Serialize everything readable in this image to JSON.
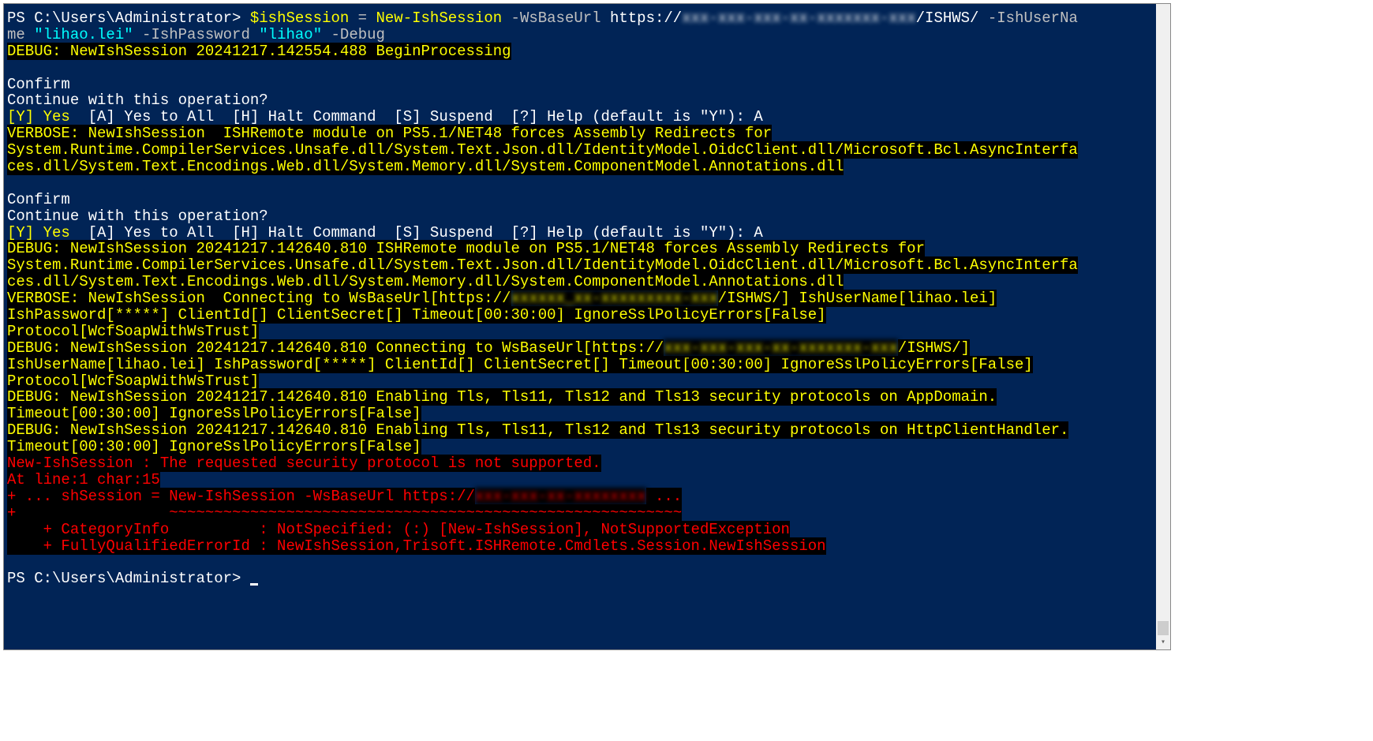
{
  "prompt1": "PS C:\\Users\\Administrator> ",
  "cmd_var": "$ishSession",
  "cmd_eq": " = ",
  "cmd_name": "New-IshSession",
  "cmd_p1": " -WsBaseUrl ",
  "cmd_url_prefix": "https://",
  "cmd_url_redacted": "xxx-xxx-xxx-xx-xxxxxxx-xxx",
  "cmd_url_suffix": "/ISHWS/",
  "cmd_p2": " -IshUserNa",
  "cmd_p2b": "me ",
  "cmd_user": "\"lihao.lei\"",
  "cmd_p3": " -IshPassword ",
  "cmd_pass": "\"lihao\"",
  "cmd_p4": " -Debug",
  "debug1": "DEBUG: NewIshSession 20241217.142554.488 BeginProcessing",
  "confirm": "Confirm",
  "confirm_q": "Continue with this operation?",
  "opt_y": "[Y] Yes",
  "opt_a": "  [A] Yes to All",
  "opt_h": "  [H] Halt Command",
  "opt_s": "  [S] Suspend",
  "opt_help": "  [?] Help (default is \"Y\"): ",
  "opt_ans": "A",
  "verbose1a": "VERBOSE: NewIshSession  ISHRemote module on PS5.1/NET48 forces Assembly Redirects for",
  "verbose1b": "System.Runtime.CompilerServices.Unsafe.dll/System.Text.Json.dll/IdentityModel.OidcClient.dll/Microsoft.Bcl.AsyncInterfa",
  "verbose1c": "ces.dll/System.Text.Encodings.Web.dll/System.Memory.dll/System.ComponentModel.Annotations.dll",
  "debug2a": "DEBUG: NewIshSession 20241217.142640.810 ISHRemote module on PS5.1/NET48 forces Assembly Redirects for",
  "debug2b": "System.Runtime.CompilerServices.Unsafe.dll/System.Text.Json.dll/IdentityModel.OidcClient.dll/Microsoft.Bcl.AsyncInterfa",
  "debug2c": "ces.dll/System.Text.Encodings.Web.dll/System.Memory.dll/System.ComponentModel.Annotations.dll",
  "verbose2a_pre": "VERBOSE: NewIshSession  Connecting to WsBaseUrl[https://",
  "verbose2a_red": "xxxxxx_xx-xxxxxxxxx-xxx",
  "verbose2a_post": "/ISHWS/] IshUserName[lihao.lei]",
  "verbose2b": "IshPassword[*****] ClientId[] ClientSecret[] Timeout[00:30:00] IgnoreSslPolicyErrors[False]",
  "verbose2c": "Protocol[WcfSoapWithWsTrust]",
  "debug3a_pre": "DEBUG: NewIshSession 20241217.142640.810 Connecting to WsBaseUrl[https://",
  "debug3a_red": "xxx-xxx-xxx-xx-xxxxxxx-xxx",
  "debug3a_post": "/ISHWS/]",
  "debug3b": "IshUserName[lihao.lei] IshPassword[*****] ClientId[] ClientSecret[] Timeout[00:30:00] IgnoreSslPolicyErrors[False]",
  "debug3c": "Protocol[WcfSoapWithWsTrust]",
  "debug4a": "DEBUG: NewIshSession 20241217.142640.810 Enabling Tls, Tls11, Tls12 and Tls13 security protocols on AppDomain.",
  "debug4b": "Timeout[00:30:00] IgnoreSslPolicyErrors[False]",
  "debug5a": "DEBUG: NewIshSession 20241217.142640.810 Enabling Tls, Tls11, Tls12 and Tls13 security protocols on HttpClientHandler.",
  "debug5b": "Timeout[00:30:00] IgnoreSslPolicyErrors[False]",
  "error1": "New-IshSession : The requested security protocol is not supported.",
  "error2": "At line:1 char:15",
  "error3_pre": "+ ... shSession = New-IshSession -WsBaseUrl https://",
  "error3_red": "xxx-xxx-xx-xxxxxxxx",
  "error3_post": " ...",
  "error4": "+                 ~~~~~~~~~~~~~~~~~~~~~~~~~~~~~~~~~~~~~~~~~~~~~~~~~~~~~~~~~",
  "error5": "    + CategoryInfo          : NotSpecified: (:) [New-IshSession], NotSupportedException",
  "error6": "    + FullyQualifiedErrorId : NewIshSession,Trisoft.ISHRemote.Cmdlets.Session.NewIshSession",
  "prompt2": "PS C:\\Users\\Administrator> "
}
